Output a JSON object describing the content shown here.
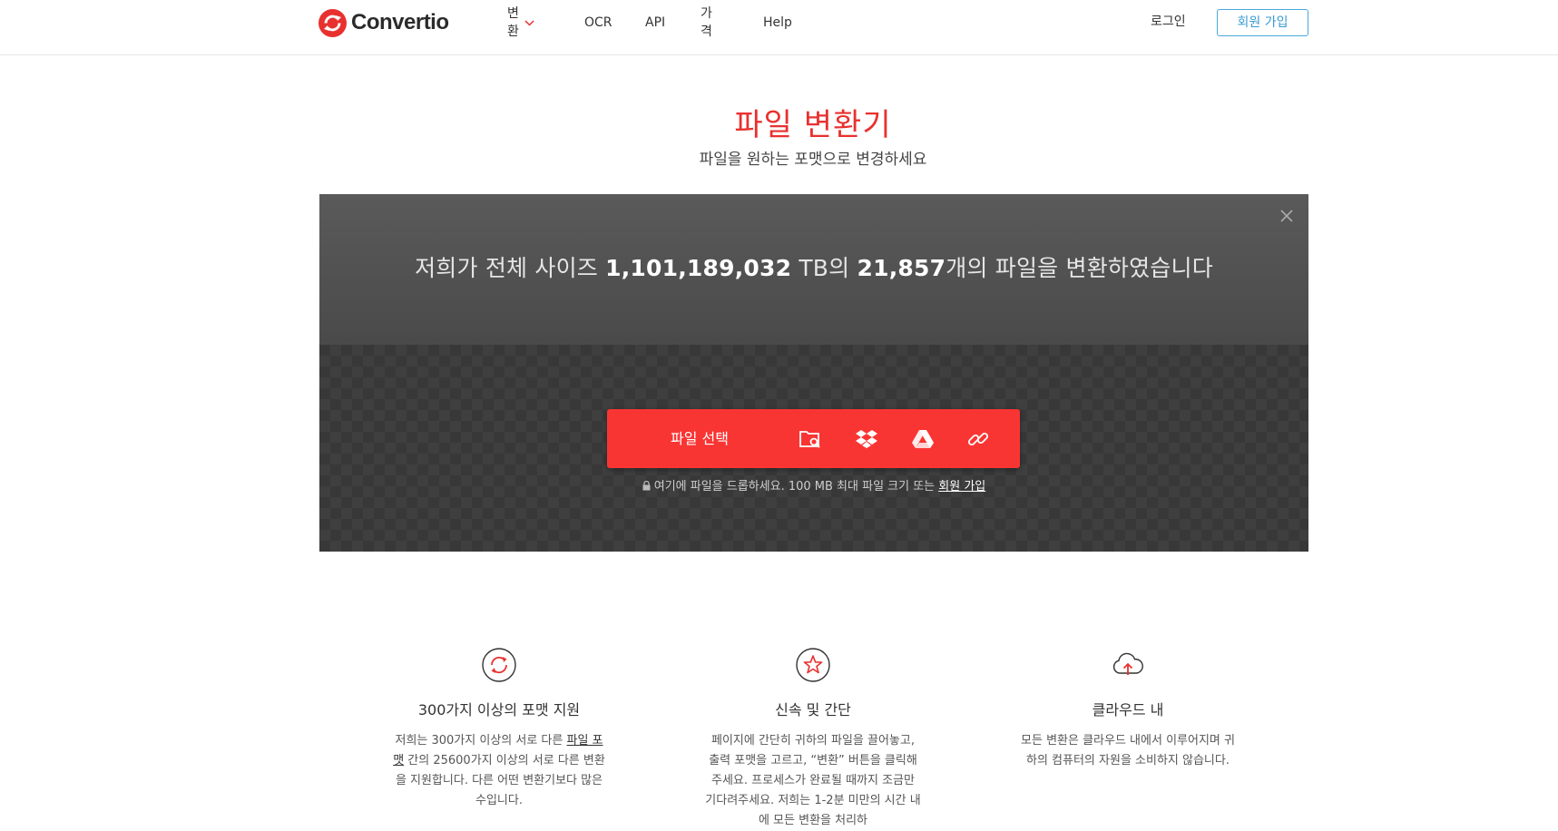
{
  "header": {
    "logo_text": "Convertio",
    "nav": [
      {
        "label": "변환",
        "has_dropdown": true
      },
      {
        "label": "OCR"
      },
      {
        "label": "API"
      },
      {
        "label": "가격"
      },
      {
        "label": "Help"
      }
    ],
    "login_label": "로그인",
    "signup_label": "회원 가입"
  },
  "hero": {
    "title": "파일 변환기",
    "subtitle": "파일을 원하는 포맷으로 변경하세요"
  },
  "converter": {
    "stats": {
      "prefix": "저희가 전체 사이즈 ",
      "size": "1,101,189,032",
      "size_unit": " TB의 ",
      "count": "21,857",
      "suffix": "개의 파일을 변환하였습니다"
    },
    "choose_label": "파일 선택",
    "sources": [
      "folder-search-icon",
      "dropbox-icon",
      "google-drive-icon",
      "url-link-icon"
    ],
    "drop_note": "여기에 파일을 드롭하세요. 100 MB 최대 파일 크기 또는 ",
    "drop_note_link": "회원 가입"
  },
  "features": [
    {
      "icon": "refresh-circle-icon",
      "title": "300가지 이상의 포맷 지원",
      "text_before": "저희는 300가지 이상의 서로 다른 ",
      "text_link": "파일 포맷",
      "text_after": " 간의 25600가지 이상의 서로 다른 변환을 지원합니다. 다른 어떤 변환기보다 많은 수입니다."
    },
    {
      "icon": "star-circle-icon",
      "title": "신속 및 간단",
      "text": "페이지에 간단히 귀하의 파일을 끌어놓고, 출력 포맷을 고르고, “변환” 버튼을 클릭해주세요. 프로세스가 완료될 때까지 조금만 기다려주세요. 저희는 1-2분 미만의 시간 내에 모든 변환을 처리하"
    },
    {
      "icon": "cloud-upload-icon",
      "title": "클라우드 내",
      "text": "모든 변환은 클라우드 내에서 이루어지며 귀하의 컴퓨터의 자원을 소비하지 않습니다."
    }
  ],
  "colors": {
    "brand_red": "#f93533",
    "title_red": "#e8312f",
    "signup_blue": "#3a9ad1"
  }
}
